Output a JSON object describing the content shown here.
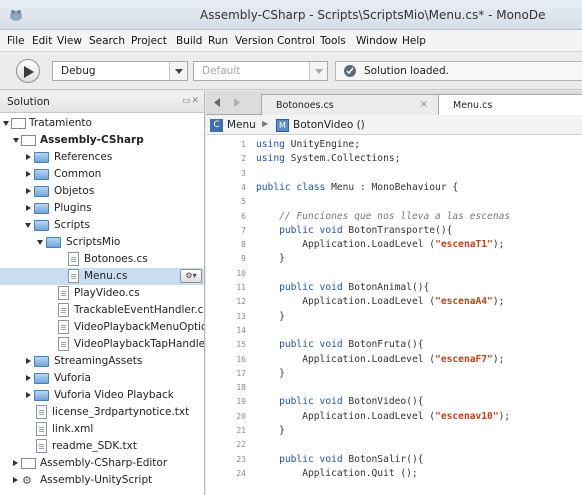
{
  "window": {
    "title": "Assembly-CSharp - Scripts\\ScriptsMio\\Menu.cs* - MonoDe"
  },
  "menu": [
    "File",
    "Edit",
    "View",
    "Search",
    "Project",
    "Build",
    "Run",
    "Version Control",
    "Tools",
    "Window",
    "Help"
  ],
  "toolbar": {
    "config": "Debug",
    "platform": "Default",
    "status": "Solution loaded."
  },
  "solution": {
    "header": "Solution",
    "rows": [
      {
        "label": "Tratamiento",
        "bold": false
      },
      {
        "label": "Assembly-CSharp",
        "bold": true
      },
      {
        "label": "References"
      },
      {
        "label": "Common"
      },
      {
        "label": "Objetos"
      },
      {
        "label": "Plugins"
      },
      {
        "label": "Scripts"
      },
      {
        "label": "ScriptsMio"
      },
      {
        "label": "Botonoes.cs"
      },
      {
        "label": "Menu.cs"
      },
      {
        "label": "PlayVideo.cs"
      },
      {
        "label": "TrackableEventHandler.cs"
      },
      {
        "label": "VideoPlaybackMenuOption"
      },
      {
        "label": "VideoPlaybackTapHandler"
      },
      {
        "label": "StreamingAssets"
      },
      {
        "label": "Vuforia"
      },
      {
        "label": "Vuforia Video Playback"
      },
      {
        "label": "license_3rdpartynotice.txt"
      },
      {
        "label": "link.xml"
      },
      {
        "label": "readme_SDK.txt"
      },
      {
        "label": "Assembly-CSharp-Editor"
      },
      {
        "label": "Assembly-UnityScript"
      }
    ]
  },
  "editor": {
    "tabs": [
      "Botonoes.cs",
      "Menu.cs"
    ],
    "path": {
      "class": "Menu",
      "member": "BotonVideo ()"
    },
    "lines": [
      {
        "n": "1",
        "html": "<span class=\"kw\">using</span> UnityEngine;"
      },
      {
        "n": "2",
        "html": "<span class=\"kw\">using</span> System.Collections;"
      },
      {
        "n": "3",
        "html": ""
      },
      {
        "n": "4",
        "html": "<span class=\"kw\">public class</span> Menu : MonoBehaviour {"
      },
      {
        "n": "5",
        "html": ""
      },
      {
        "n": "6",
        "html": "    <span class=\"cmt\">// Funciones que nos lleva a las escenas</span>"
      },
      {
        "n": "7",
        "html": "    <span class=\"kw\">public void</span> BotonTransporte(){"
      },
      {
        "n": "8",
        "html": "        Application.LoadLevel (<span class=\"str\">\"escenaT1\"</span>);"
      },
      {
        "n": "9",
        "html": "    }"
      },
      {
        "n": "10",
        "html": ""
      },
      {
        "n": "11",
        "html": "    <span class=\"kw\">public void</span> BotonAnimal(){"
      },
      {
        "n": "12",
        "html": "        Application.LoadLevel (<span class=\"str\">\"escenaA4\"</span>);"
      },
      {
        "n": "13",
        "html": "    }"
      },
      {
        "n": "14",
        "html": ""
      },
      {
        "n": "15",
        "html": "    <span class=\"kw\">public void</span> BotonFruta(){"
      },
      {
        "n": "16",
        "html": "        Application.LoadLevel (<span class=\"str\">\"escenaF7\"</span>);"
      },
      {
        "n": "17",
        "html": "    }"
      },
      {
        "n": "18",
        "html": ""
      },
      {
        "n": "19",
        "html": "    <span class=\"kw\">public void</span> BotonVideo(){"
      },
      {
        "n": "20",
        "html": "        Application.LoadLevel (<span class=\"str\">\"escenav10\"</span>);"
      },
      {
        "n": "21",
        "html": "    }"
      },
      {
        "n": "22",
        "html": ""
      },
      {
        "n": "23",
        "html": "    <span class=\"kw\">public void</span> BotonSalir(){"
      },
      {
        "n": "24",
        "html": "        Application.Quit ();"
      }
    ]
  }
}
